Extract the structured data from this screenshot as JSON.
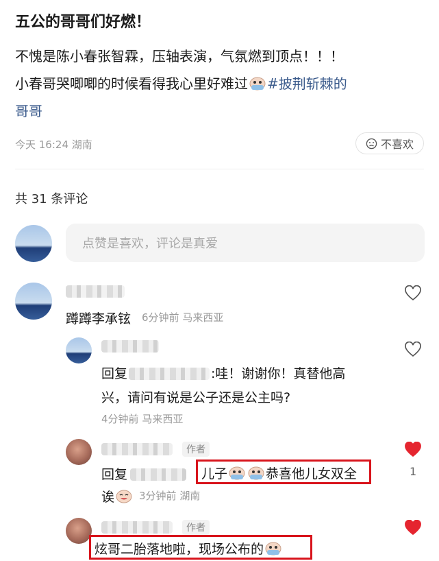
{
  "post": {
    "title": "五公的哥哥们好燃！",
    "body_line1": "不愧是陈小春张智霖，压轴表演，气氛燃到顶点！！！",
    "body_line2": "小春哥哭唧唧的时候看得我心里好难过",
    "hashtag_part1": "#披荆斩棘的",
    "hashtag_part2": "哥哥",
    "time": "今天 16:24",
    "location": "湖南",
    "dislike_label": "不喜欢"
  },
  "comments_header": "共 31 条评论",
  "comment_input_placeholder": "点赞是喜欢，评论是真爱",
  "comments": [
    {
      "text": "蹲蹲李承铉",
      "time": "6分钟前",
      "location": "马来西亚"
    },
    {
      "reply_prefix": "回复",
      "text_line1": ":哇！谢谢你！真替他高",
      "text_line2": "兴，请问有说是公子还是公主吗?",
      "time": "4分钟前",
      "location": "马来西亚"
    },
    {
      "author_tag": "作者",
      "reply_prefix": "回复",
      "highlight_part1": "儿子",
      "highlight_part2": "恭喜他儿女双全",
      "text_line2": "诶",
      "time": "3分钟前",
      "location": "湖南",
      "like_count": "1",
      "liked_color": "#e5252f"
    },
    {
      "author_tag": "作者",
      "highlight_text": "炫哥二胎落地啦，现场公布的"
    }
  ],
  "colors": {
    "accent_red": "#d8141c",
    "hashtag": "#3b5b8c",
    "heart_liked": "#e5252f"
  }
}
